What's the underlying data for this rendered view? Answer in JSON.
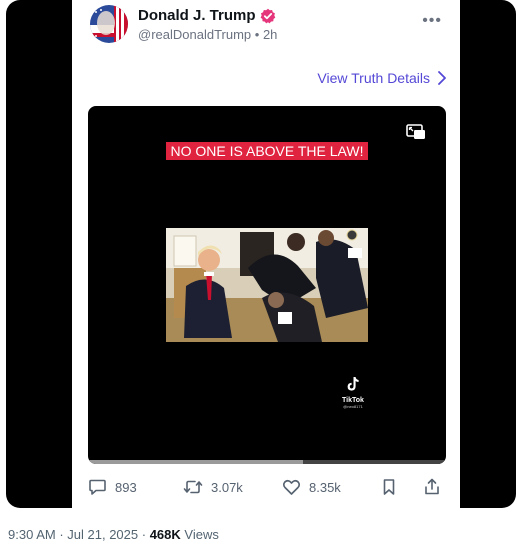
{
  "post": {
    "author_name": "Donald J. Trump",
    "handle": "@realDonaldTrump",
    "time_ago": "2h",
    "more_label": "•••",
    "view_details": "View Truth Details"
  },
  "video": {
    "caption": "NO ONE IS ABOVE THE LAW!",
    "watermark_app": "TikTok",
    "watermark_user": "@neo8171",
    "progress": 0.6
  },
  "actions": {
    "replies": "893",
    "retruths": "3.07k",
    "likes": "8.35k"
  },
  "footer": {
    "time": "9:30 AM",
    "date": "Jul 21, 2025",
    "views_count": "468K",
    "views_label": "Views"
  },
  "colors": {
    "accent": "#5448d6",
    "caption_bg": "#e0243f",
    "verified": "#e5367c"
  }
}
